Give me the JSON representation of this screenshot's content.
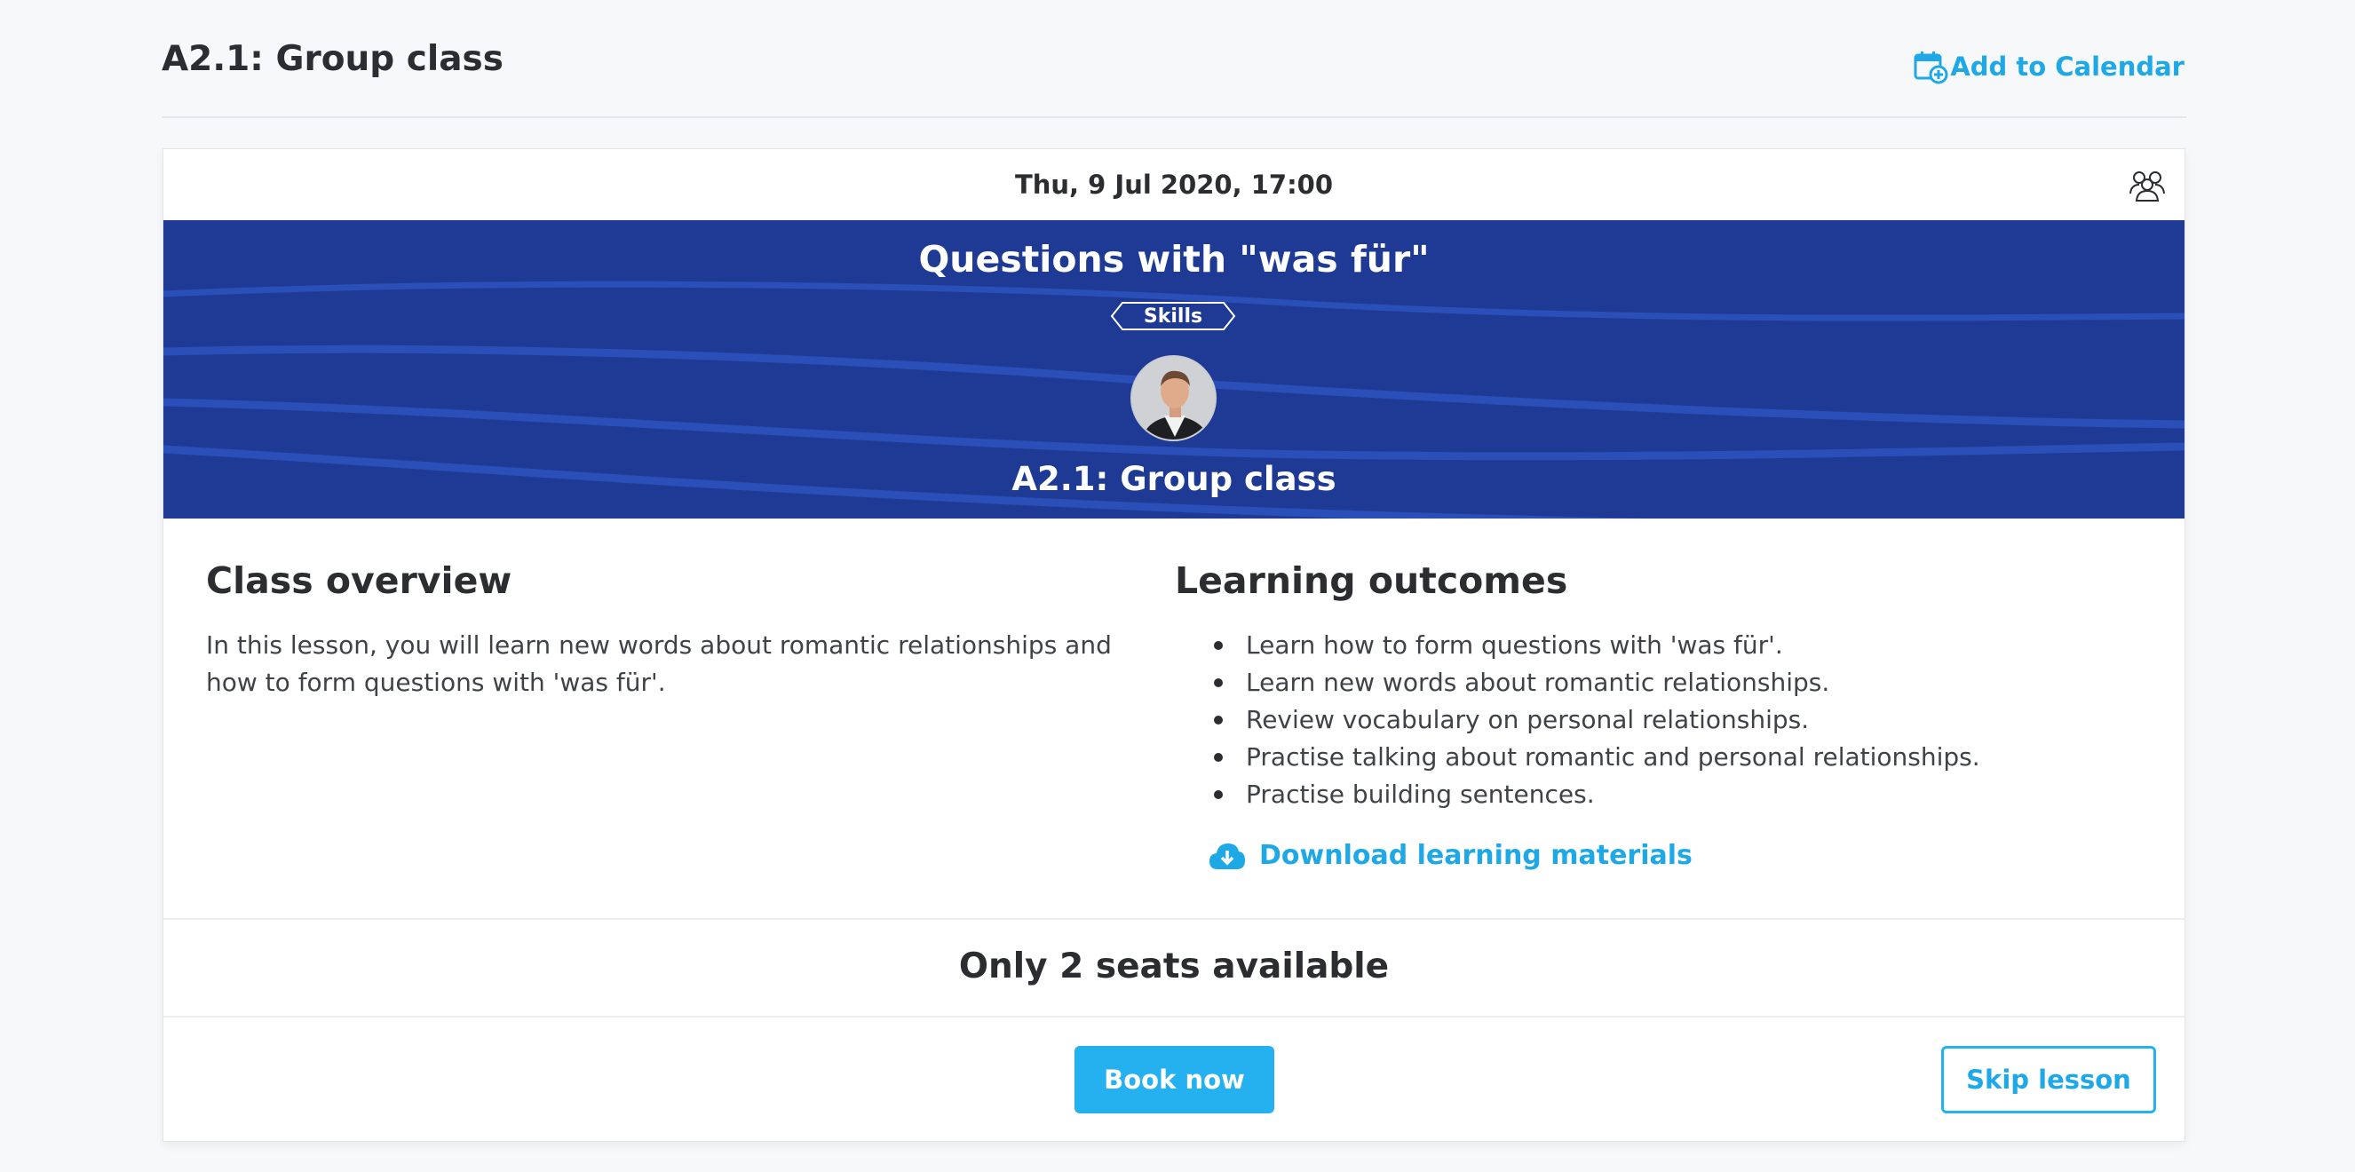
{
  "header": {
    "title": "A2.1: Group class",
    "add_to_calendar_label": "Add to Calendar"
  },
  "card": {
    "datetime": "Thu, 9 Jul 2020, 17:00",
    "banner": {
      "title": "Questions with \"was für\"",
      "badge": "Skills",
      "subtitle": "A2.1: Group class"
    },
    "overview": {
      "heading": "Class overview",
      "text": "In this lesson, you will learn new words about romantic relationships and how to form questions with 'was für'."
    },
    "outcomes": {
      "heading": "Learning outcomes",
      "items": [
        "Learn how to form questions with 'was für'.",
        "Learn new words about romantic relationships.",
        "Review vocabulary on personal relationships.",
        "Practise talking about romantic and personal relationships.",
        "Practise building sentences."
      ],
      "download_label": "Download learning materials"
    },
    "seats_text": "Only 2 seats available",
    "book_label": "Book now",
    "skip_label": "Skip lesson"
  },
  "colors": {
    "accent": "#25b1f0",
    "link": "#1fa8e6",
    "banner": "#1e3a95",
    "text": "#2b2d31"
  },
  "icons": {
    "calendar": "calendar-add-icon",
    "group": "group-icon",
    "download": "cloud-download-icon"
  }
}
